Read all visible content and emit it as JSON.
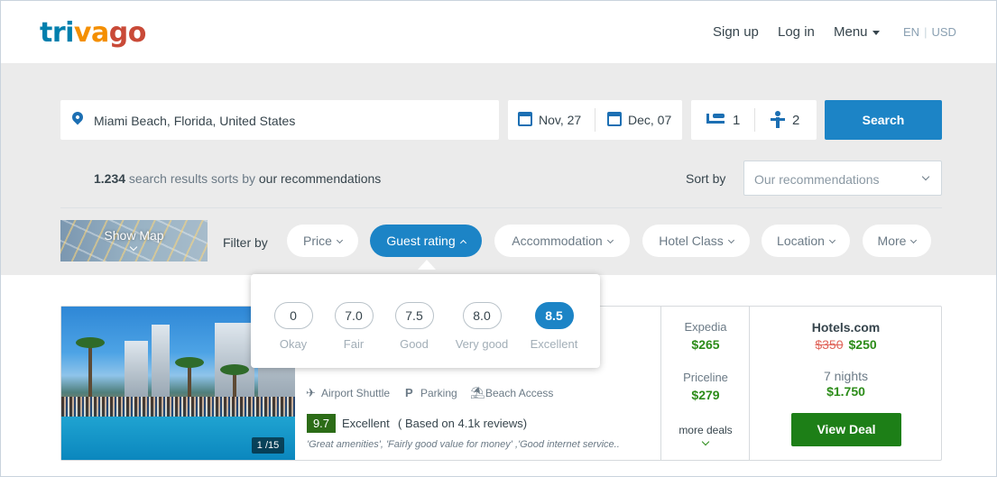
{
  "header": {
    "logo": [
      "tri",
      "va",
      "go"
    ],
    "signup": "Sign up",
    "login": "Log in",
    "menu": "Menu",
    "lang": "EN",
    "currency": "USD"
  },
  "search": {
    "destination": "Miami Beach, Florida, United States",
    "checkin": "Nov, 27",
    "checkout": "Dec, 07",
    "rooms": "1",
    "guests": "2",
    "button": "Search"
  },
  "results_bar": {
    "count": "1.234",
    "middle": " search results sorts by ",
    "sort_label": "our recommendations",
    "sortby": "Sort by",
    "sort_value": "Our recommendations"
  },
  "filters": {
    "show_map": "Show Map",
    "filter_by": "Filter by",
    "pills": [
      "Price",
      "Guest rating",
      "Accommodation",
      "Hotel Class",
      "Location",
      "More"
    ],
    "active": "Guest rating"
  },
  "rating_popup": {
    "options": [
      {
        "value": "0",
        "label": "Okay"
      },
      {
        "value": "7.0",
        "label": "Fair"
      },
      {
        "value": "7.5",
        "label": "Good"
      },
      {
        "value": "8.0",
        "label": "Very good"
      },
      {
        "value": "8.5",
        "label": "Excellent"
      }
    ],
    "selected": "8.5"
  },
  "hotel": {
    "image_counter": "1 /15",
    "amenities": [
      "Airport Shuttle",
      "Parking",
      "Beach Access"
    ],
    "rating": "9.7",
    "rating_word": "Excellent",
    "reviews": "( Based on 4.1k reviews)",
    "snippet": "'Great amenities', 'Fairly good value for money' ,'Good internet service..",
    "deals": [
      {
        "site": "Expedia",
        "price": "$265"
      },
      {
        "site": "Priceline",
        "price": "$279"
      }
    ],
    "more_deals": "more deals",
    "best": {
      "site": "Hotels.com",
      "old_price": "$350",
      "price": "$250",
      "nights": "7 nights",
      "total": "$1.750",
      "button": "View Deal"
    }
  },
  "colors": {
    "brand_blue": "#1c84c6",
    "deal_green": "#2c8c19",
    "view_deal_green": "#1d7f17"
  }
}
